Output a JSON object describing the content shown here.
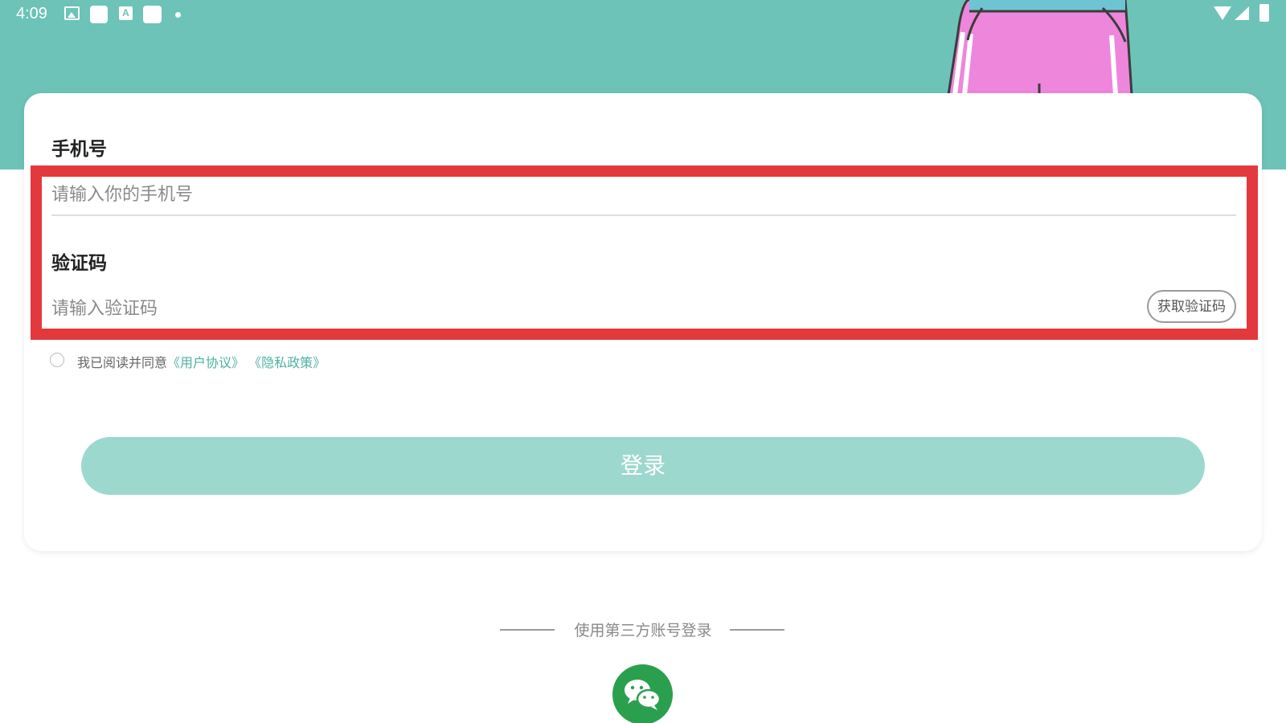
{
  "status_bar": {
    "time": "4:09",
    "icons": [
      "image-icon",
      "notification-square-icon",
      "a-box-icon",
      "notification-square-icon",
      "dot-icon",
      "wifi-icon",
      "signal-icon",
      "battery-icon"
    ]
  },
  "form": {
    "phone_label": "手机号",
    "phone_placeholder": "请输入你的手机号",
    "code_label": "验证码",
    "code_placeholder": "请输入验证码",
    "get_code_button": "获取验证码"
  },
  "agreement": {
    "prefix": "我已阅读并同意",
    "user_agreement": "《用户协议》",
    "privacy_policy": "《隐私政策》"
  },
  "login_button": "登录",
  "third_party": {
    "label": "使用第三方账号登录",
    "wechat_icon": "wechat-icon"
  },
  "colors": {
    "header": "#6dc3b7",
    "accent": "#4eb1a2",
    "login_button": "#9dd8cf",
    "highlight": "#e4393c",
    "wechat": "#2aa04f"
  }
}
